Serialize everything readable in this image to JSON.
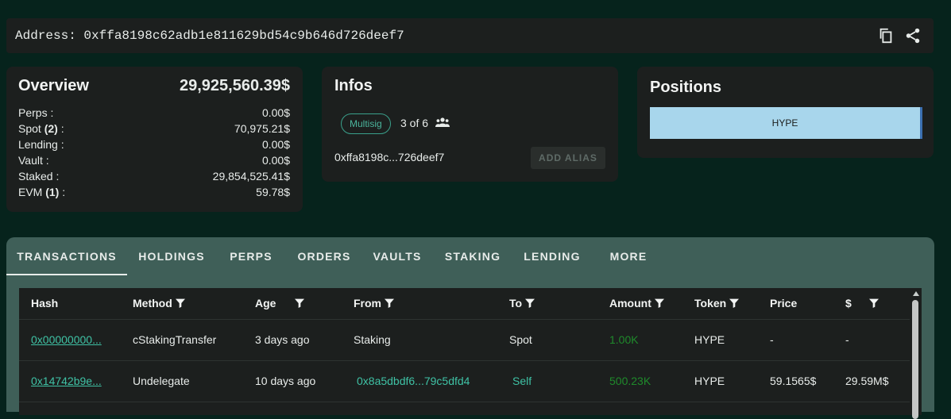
{
  "address_bar": {
    "text": "Address: 0xffa8198c62adb1e811629bd54c9b646d726deef7",
    "icons": [
      "copy-icon",
      "share-icon"
    ]
  },
  "overview": {
    "title": "Overview",
    "total": "29,925,560.39$",
    "rows": [
      {
        "label": "Perps :",
        "value": "0.00$"
      },
      {
        "label_pre": "Spot ",
        "count": "(2)",
        "label_post": " :",
        "value": "70,975.21$"
      },
      {
        "label": "Lending :",
        "value": "0.00$"
      },
      {
        "label": "Vault :",
        "value": "0.00$"
      },
      {
        "label": "Staked :",
        "value": "29,854,525.41$"
      },
      {
        "label_pre": "EVM ",
        "count": "(1)",
        "label_post": " :",
        "value": "59.78$"
      }
    ]
  },
  "infos": {
    "title": "Infos",
    "chip": "Multisig",
    "signers": "3 of 6",
    "short_address": "0xffa8198c...726deef7",
    "alias_button": "ADD ALIAS"
  },
  "positions": {
    "title": "Positions",
    "items": [
      {
        "label": "HYPE",
        "share": 1.0
      }
    ]
  },
  "tabs": [
    "TRANSACTIONS",
    "HOLDINGS",
    "PERPS",
    "ORDERS",
    "VAULTS",
    "STAKING",
    "LENDING",
    "MORE"
  ],
  "active_tab": "TRANSACTIONS",
  "table": {
    "headers": [
      "Hash",
      "Method",
      "Age",
      "From",
      "To",
      "Amount",
      "Token",
      "Price",
      "$"
    ],
    "rows": [
      {
        "hash": "0x00000000...",
        "method": "cStakingTransfer",
        "age": "3 days ago",
        "from": "Staking",
        "to": "Spot",
        "amount": "1.00K",
        "token": "HYPE",
        "price": "-",
        "usd": "-"
      },
      {
        "hash": "0x14742b9e...",
        "method": "Undelegate",
        "age": "10 days ago",
        "from": "0x8a5dbdf6...79c5dfd4",
        "to": "Self",
        "amount": "500.23K",
        "token": "HYPE",
        "price": "59.1565$",
        "usd": "29.59M$"
      }
    ]
  },
  "colors": {
    "background": "#06231c",
    "card": "#1c1f1e",
    "accent": "#3fc2a5",
    "tab_bar": "#3f5f58",
    "position_bar": "#a8d6ec",
    "amount_green": "#1f8a2b"
  }
}
